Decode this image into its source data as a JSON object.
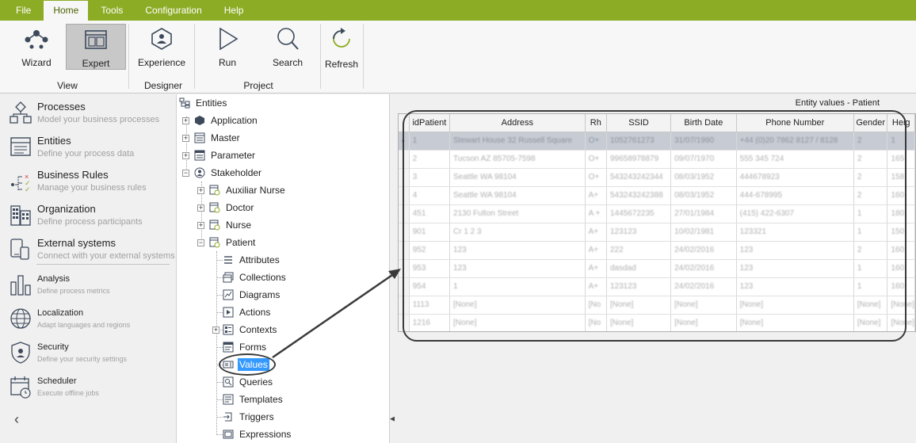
{
  "menu": {
    "items": [
      "File",
      "Home",
      "Tools",
      "Configuration",
      "Help"
    ],
    "active": "Home"
  },
  "ribbon": {
    "buttons": {
      "wizard": "Wizard",
      "expert": "Expert",
      "experience": "Experience",
      "run": "Run",
      "search": "Search",
      "refresh": "Refresh"
    },
    "groups": {
      "view": "View",
      "designer": "Designer",
      "project": "Project"
    }
  },
  "nav": [
    {
      "title": "Processes",
      "subtitle": "Model your business processes",
      "icon": "processes-icon"
    },
    {
      "title": "Entities",
      "subtitle": "Define your process data",
      "icon": "entities-icon"
    },
    {
      "title": "Business Rules",
      "subtitle": "Manage your business rules",
      "icon": "business-rules-icon"
    },
    {
      "title": "Organization",
      "subtitle": "Define process participants",
      "icon": "organization-icon"
    },
    {
      "title": "External systems",
      "subtitle": "Connect with your external systems",
      "icon": "external-systems-icon"
    },
    {
      "title": "Analysis",
      "subtitle": "Define process metrics",
      "icon": "analysis-icon"
    },
    {
      "title": "Localization",
      "subtitle": "Adapt languages and regions",
      "icon": "globe-icon"
    },
    {
      "title": "Security",
      "subtitle": "Define your security settings",
      "icon": "security-icon"
    },
    {
      "title": "Scheduler",
      "subtitle": "Execute offline jobs",
      "icon": "scheduler-icon"
    }
  ],
  "tree": {
    "root": "Entities",
    "application": "Application",
    "master": "Master",
    "parameter": "Parameter",
    "stakeholder": "Stakeholder",
    "auxiliar_nurse": "Auxiliar Nurse",
    "doctor": "Doctor",
    "nurse": "Nurse",
    "patient": "Patient",
    "patient_children": [
      "Attributes",
      "Collections",
      "Diagrams",
      "Actions",
      "Contexts",
      "Forms",
      "Values",
      "Queries",
      "Templates",
      "Triggers",
      "Expressions"
    ],
    "selected": "Values"
  },
  "grid": {
    "title": "Entity values - Patient",
    "columns": [
      "idPatient",
      "Address",
      "Rh",
      "SSID",
      "Birth Date",
      "Phone Number",
      "Gender",
      "Heig"
    ],
    "rows": [
      [
        "1",
        "Stewart House 32 Russell Square",
        "O+",
        "1052761273",
        "31/07/1990",
        "+44 (0)20 7862 8127 / 8128",
        "2",
        "1"
      ],
      [
        "2",
        "Tucson AZ 85705-7598",
        "O+",
        "99658978879",
        "09/07/1970",
        "555 345 724",
        "2",
        "165"
      ],
      [
        "3",
        "Seattle WA 98104",
        "O+",
        "543243242344",
        "08/03/1952",
        "444678923",
        "2",
        "158"
      ],
      [
        "4",
        "Seattle WA 98104",
        "A+",
        "543243242388",
        "08/03/1952",
        "444-678995",
        "2",
        "160"
      ],
      [
        "451",
        "2130 Fulton Street",
        "A +",
        "1445672235",
        "27/01/1984",
        "(415) 422-6307",
        "1",
        "180"
      ],
      [
        "901",
        "Cr 1 2 3",
        "A+",
        "123123",
        "10/02/1981",
        "123321",
        "1",
        "150"
      ],
      [
        "952",
        "123",
        "A+",
        "222",
        "24/02/2016",
        "123",
        "2",
        "160"
      ],
      [
        "953",
        "123",
        "A+",
        "dasdad",
        "24/02/2016",
        "123",
        "1",
        "160"
      ],
      [
        "954",
        "1",
        "A+",
        "123123",
        "24/02/2016",
        "123",
        "1",
        "160"
      ],
      [
        "1113",
        "[None]",
        "[No",
        "[None]",
        "[None]",
        "[None]",
        "[None]",
        "[None]"
      ],
      [
        "1216",
        "[None]",
        "[No",
        "[None]",
        "[None]",
        "[None]",
        "[None]",
        "[None]"
      ]
    ]
  },
  "colors": {
    "menubar": "#8dac26",
    "selection": "#3399ff",
    "annotation": "#3a3a3a"
  }
}
